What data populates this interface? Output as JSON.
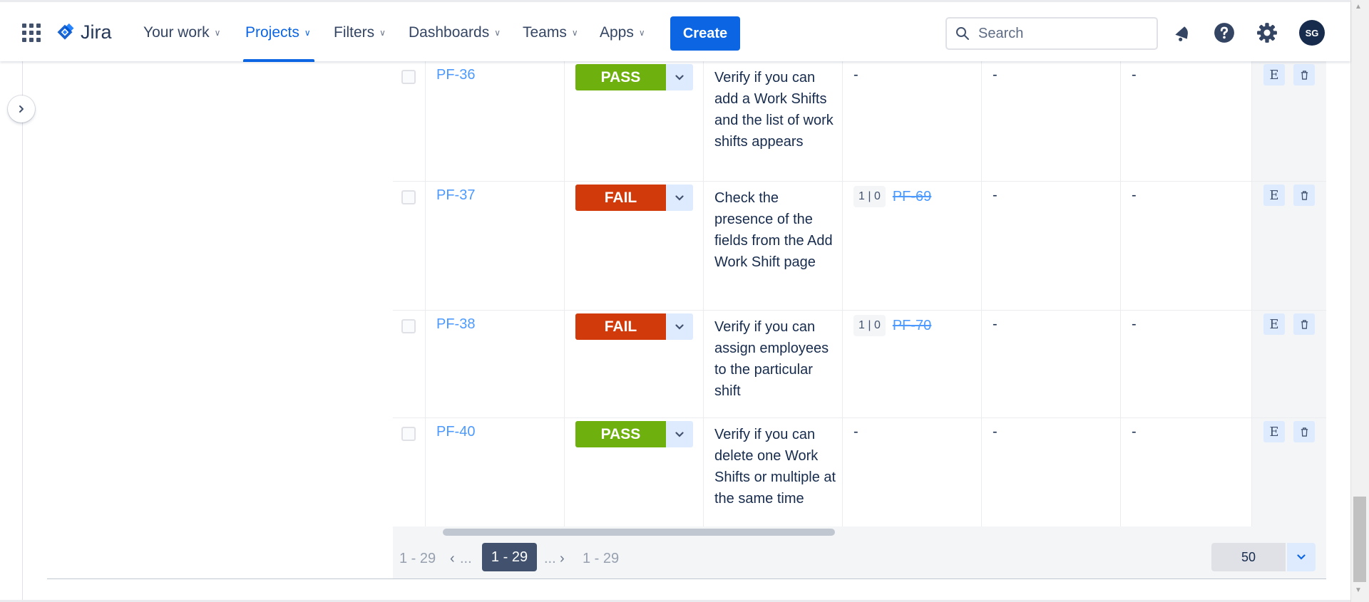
{
  "app": {
    "name": "Jira",
    "nav": [
      {
        "label": "Your work",
        "active": false
      },
      {
        "label": "Projects",
        "active": true
      },
      {
        "label": "Filters",
        "active": false
      },
      {
        "label": "Dashboards",
        "active": false
      },
      {
        "label": "Teams",
        "active": false
      },
      {
        "label": "Apps",
        "active": false
      }
    ],
    "create_label": "Create",
    "search_placeholder": "Search",
    "avatar_initials": "SG",
    "accent": "#0c66e4"
  },
  "rows": [
    {
      "key": "PF-36",
      "status": "PASS",
      "summary": "Verify if you can add a Work Shifts and the list of work shifts appears",
      "defects": null,
      "defects_dash": "-",
      "col_a": "-",
      "col_b": "-",
      "action_e": "E"
    },
    {
      "key": "PF-37",
      "status": "FAIL",
      "summary": "Check the presence of the fields from the Add Work Shift page",
      "defects": {
        "count": "1 | 0",
        "link": "PF-69"
      },
      "col_a": "-",
      "col_b": "-",
      "action_e": "E"
    },
    {
      "key": "PF-38",
      "status": "FAIL",
      "summary": "Verify if you can assign employees to the particular shift",
      "defects": {
        "count": "1 | 0",
        "link": "PF-70"
      },
      "col_a": "-",
      "col_b": "-",
      "action_e": "E"
    },
    {
      "key": "PF-40",
      "status": "PASS",
      "summary": "Verify if you can delete one Work Shifts or multiple at the same time",
      "defects": null,
      "defects_dash": "-",
      "col_a": "-",
      "col_b": "-",
      "action_e": "E"
    }
  ],
  "status_colors": {
    "PASS": "#6eb00e",
    "FAIL": "#d13a0b"
  },
  "pagination": {
    "first": "1 - 29",
    "prev_ellipsis": "...",
    "current": "1 - 29",
    "next_ellipsis": "...",
    "last": "1 - 29",
    "page_size": "50"
  }
}
